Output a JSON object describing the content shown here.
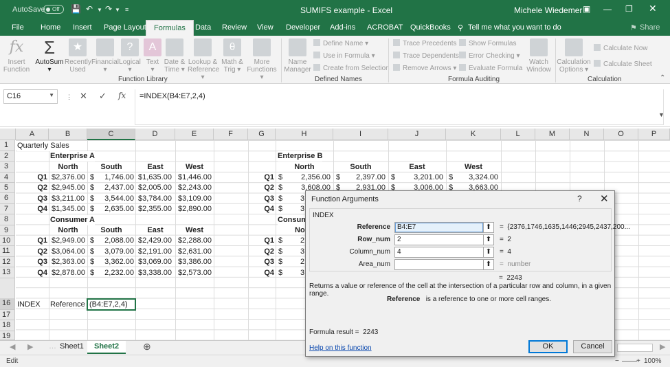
{
  "titlebar": {
    "autosave_label": "AutoSave",
    "autosave_state": "Off",
    "document": "SUMIFS example  -  Excel",
    "user": "Michele Wiedemer"
  },
  "menu_tabs": [
    "File",
    "Home",
    "Insert",
    "Page Layout",
    "Formulas",
    "Data",
    "Review",
    "View",
    "Developer",
    "Add-ins",
    "ACROBAT",
    "QuickBooks"
  ],
  "menu_active": "Formulas",
  "tell_me": "Tell me what you want to do",
  "share": "Share",
  "ribbon": {
    "insert_function": [
      "Insert",
      "Function"
    ],
    "autosum": "AutoSum",
    "recently_used": [
      "Recently",
      "Used"
    ],
    "financial": "Financial",
    "logical": "Logical",
    "text": "Text",
    "date_time": [
      "Date &",
      "Time"
    ],
    "lookup": [
      "Lookup &",
      "Reference"
    ],
    "math": [
      "Math &",
      "Trig"
    ],
    "more": [
      "More",
      "Functions"
    ],
    "name_manager": [
      "Name",
      "Manager"
    ],
    "define_name": "Define Name",
    "use_in_formula": "Use in Formula",
    "create_from_selection": "Create from Selection",
    "trace_precedents": "Trace Precedents",
    "trace_dependents": "Trace Dependents",
    "remove_arrows": "Remove Arrows",
    "show_formulas": "Show Formulas",
    "error_checking": "Error Checking",
    "evaluate_formula": "Evaluate Formula",
    "watch_window": [
      "Watch",
      "Window"
    ],
    "calc_options": [
      "Calculation",
      "Options"
    ],
    "calculate_now": "Calculate Now",
    "calculate_sheet": "Calculate Sheet",
    "groups": [
      "Function Library",
      "Defined Names",
      "Formula Auditing",
      "Calculation"
    ]
  },
  "formula_bar": {
    "name_box": "C16",
    "formula": "=INDEX(B4:E7,2,4)"
  },
  "columns": [
    "A",
    "B",
    "C",
    "D",
    "E",
    "F",
    "G",
    "H",
    "I",
    "J",
    "K",
    "L",
    "M",
    "N",
    "O",
    "P"
  ],
  "rows": [
    "1",
    "2",
    "3",
    "4",
    "5",
    "6",
    "7",
    "8",
    "9",
    "10",
    "11",
    "12",
    "13",
    "16",
    "17",
    "18",
    "19"
  ],
  "sheet": {
    "a1": "Quarterly Sales",
    "ent_a": "Enterprise A",
    "ent_b": "Enterprise B",
    "cons_a": "Consumer A",
    "cons_b": "Consum",
    "regions": [
      "North",
      "South",
      "East",
      "West"
    ],
    "quarters": [
      "Q1",
      "Q2",
      "Q3",
      "Q4"
    ],
    "ent_a_data": [
      [
        "$2,376.00",
        "$",
        "1,746.00",
        "$1,635.00",
        "$1,446.00"
      ],
      [
        "$2,945.00",
        "$",
        "2,437.00",
        "$2,005.00",
        "$2,243.00"
      ],
      [
        "$3,211.00",
        "$",
        "3,544.00",
        "$3,784.00",
        "$3,109.00"
      ],
      [
        "$1,345.00",
        "$",
        "2,635.00",
        "$2,355.00",
        "$2,890.00"
      ]
    ],
    "cons_a_data": [
      [
        "$2,949.00",
        "$",
        "2,088.00",
        "$2,429.00",
        "$2,288.00"
      ],
      [
        "$3,064.00",
        "$",
        "3,079.00",
        "$2,191.00",
        "$2,631.00"
      ],
      [
        "$2,363.00",
        "$",
        "3,362.00",
        "$3,069.00",
        "$3,386.00"
      ],
      [
        "$2,878.00",
        "$",
        "2,232.00",
        "$3,338.00",
        "$2,573.00"
      ]
    ],
    "ent_b_row1": [
      "$",
      "2,356.00",
      "$",
      "2,397.00",
      "$",
      "3,201.00",
      "$",
      "3,324.00"
    ],
    "ent_b_row2": [
      "$",
      "3,608.00",
      "$",
      "2,931.00",
      "$",
      "3,006.00",
      "$",
      "3,663.00"
    ],
    "ent_b_row3": [
      "$",
      "3"
    ],
    "ent_b_row4": [
      "$",
      "3"
    ],
    "cons_b_north": "No",
    "cons_b_rows": [
      [
        "$",
        "2"
      ],
      [
        "$",
        "3"
      ],
      [
        "$",
        "2"
      ],
      [
        "$",
        "3"
      ]
    ],
    "index_label": "INDEX",
    "reference_label": "Reference",
    "c16": "(B4:E7,2,4)"
  },
  "sheet_tabs": [
    "Sheet1",
    "Sheet2"
  ],
  "active_sheet": "Sheet2",
  "status": {
    "mode": "Edit",
    "zoom": "100%"
  },
  "dialog": {
    "title": "Function Arguments",
    "help": "?",
    "function": "INDEX",
    "args": [
      {
        "label": "Reference",
        "value": "B4:E7",
        "result": "{2376,1746,1635,1446;2945,2437,200..."
      },
      {
        "label": "Row_num",
        "value": "2",
        "result": "2"
      },
      {
        "label": "Column_num",
        "value": "4",
        "result": "4"
      },
      {
        "label": "Area_num",
        "value": "",
        "result": "number"
      }
    ],
    "eq": "=",
    "value": "2243",
    "description": "Returns a value or reference of the cell at the intersection of a particular row and column, in a given range.",
    "arg_desc_name": "Reference",
    "arg_desc": "is a reference to one or more cell ranges.",
    "formula_result_label": "Formula result =",
    "formula_result": "2243",
    "help_link": "Help on this function",
    "ok": "OK",
    "cancel": "Cancel"
  }
}
